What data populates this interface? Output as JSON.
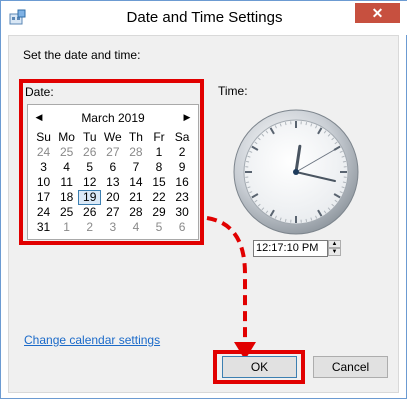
{
  "window": {
    "title": "Date and Time Settings",
    "close_glyph": "✕"
  },
  "heading": "Set the date and time:",
  "date_label": "Date:",
  "time_label": "Time:",
  "calendar": {
    "month_year": "March 2019",
    "prev_glyph": "◀",
    "next_glyph": "▶",
    "weekdays": [
      "Su",
      "Mo",
      "Tu",
      "We",
      "Th",
      "Fr",
      "Sa"
    ],
    "days": [
      {
        "n": "24",
        "other": true
      },
      {
        "n": "25",
        "other": true
      },
      {
        "n": "26",
        "other": true
      },
      {
        "n": "27",
        "other": true
      },
      {
        "n": "28",
        "other": true
      },
      {
        "n": "1"
      },
      {
        "n": "2"
      },
      {
        "n": "3"
      },
      {
        "n": "4"
      },
      {
        "n": "5"
      },
      {
        "n": "6"
      },
      {
        "n": "7"
      },
      {
        "n": "8"
      },
      {
        "n": "9"
      },
      {
        "n": "10"
      },
      {
        "n": "11"
      },
      {
        "n": "12"
      },
      {
        "n": "13"
      },
      {
        "n": "14"
      },
      {
        "n": "15"
      },
      {
        "n": "16"
      },
      {
        "n": "17"
      },
      {
        "n": "18"
      },
      {
        "n": "19",
        "today": true
      },
      {
        "n": "20"
      },
      {
        "n": "21"
      },
      {
        "n": "22"
      },
      {
        "n": "23"
      },
      {
        "n": "24"
      },
      {
        "n": "25"
      },
      {
        "n": "26"
      },
      {
        "n": "27"
      },
      {
        "n": "28"
      },
      {
        "n": "29"
      },
      {
        "n": "30"
      },
      {
        "n": "31"
      },
      {
        "n": "1",
        "other": true
      },
      {
        "n": "2",
        "other": true
      },
      {
        "n": "3",
        "other": true
      },
      {
        "n": "4",
        "other": true
      },
      {
        "n": "5",
        "other": true
      },
      {
        "n": "6",
        "other": true
      }
    ]
  },
  "clock": {
    "hour": 12,
    "minute": 17,
    "second": 10
  },
  "time_value": "12:17:10 PM",
  "spin": {
    "up": "▲",
    "down": "▼"
  },
  "change_calendar_link": "Change calendar settings",
  "buttons": {
    "ok": "OK",
    "cancel": "Cancel"
  },
  "colors": {
    "highlight": "#e10000",
    "link": "#1b6ac9",
    "close": "#c7503f"
  },
  "icons": {
    "app": "control-panel-icon",
    "close": "close-icon"
  }
}
